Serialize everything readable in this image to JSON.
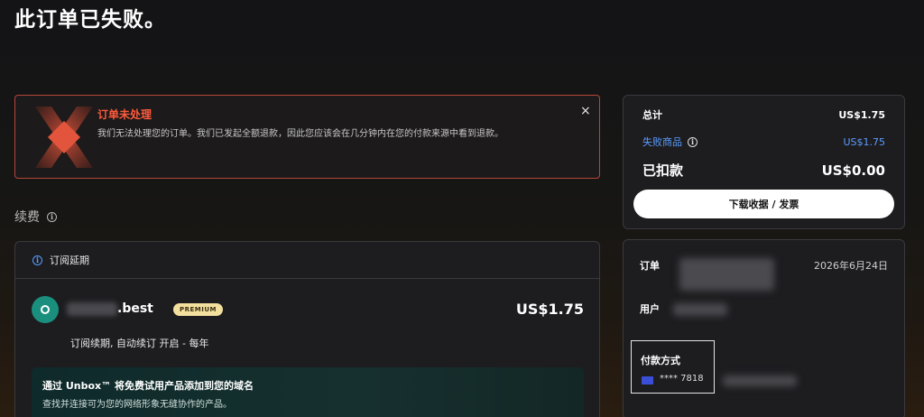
{
  "page": {
    "title": "此订单已失败。"
  },
  "alert": {
    "title": "订单未处理",
    "message": "我们无法处理您的订单。我们已发起全额退款，因此您应该会在几分钟内在您的付款来源中看到退款。",
    "close_icon": "×",
    "accent_color": "#ff5a3c"
  },
  "renewal": {
    "section_label": "续费",
    "card_header": "订阅延期",
    "domain_suffix": ".best",
    "badge": "PREMIUM",
    "price": "US$1.75",
    "renew_info": "订阅续期, 自动续订 开启 - 每年",
    "promo_title": "通过 Unbox™ 将免费试用产品添加到您的域名",
    "promo_subtitle": "查找并连接可为您的网络形象无缝协作的产品。"
  },
  "summary": {
    "total_label": "总计",
    "total_value": "US$1.75",
    "failed_label": "失败商品",
    "failed_value": "US$1.75",
    "charged_label": "已扣款",
    "charged_value": "US$0.00",
    "download_button": "下载收据 / 发票",
    "link_color": "#5b9cff"
  },
  "order": {
    "order_label": "订单",
    "order_date": "2026年6月24日",
    "user_label": "用户",
    "payment_label": "付款方式",
    "card_masked": "**** 7818"
  }
}
